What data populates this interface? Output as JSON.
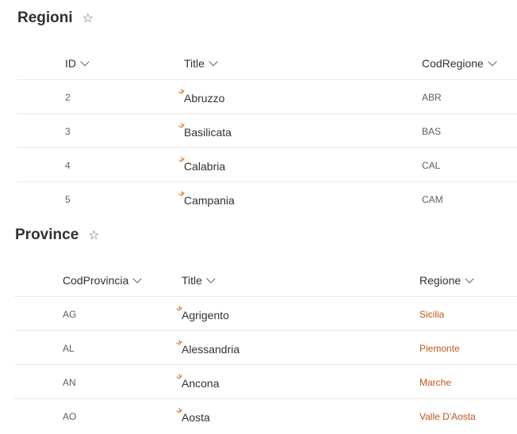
{
  "regioni": {
    "title": "Regioni",
    "star": "☆",
    "columns": {
      "id": "ID",
      "title": "Title",
      "cod": "CodRegione"
    },
    "rows": [
      {
        "id": "2",
        "title": "Abruzzo",
        "cod": "ABR"
      },
      {
        "id": "3",
        "title": "Basilicata",
        "cod": "BAS"
      },
      {
        "id": "4",
        "title": "Calabria",
        "cod": "CAL"
      },
      {
        "id": "5",
        "title": "Campania",
        "cod": "CAM"
      }
    ]
  },
  "province": {
    "title": "Province",
    "star": "☆",
    "columns": {
      "cod": "CodProvincia",
      "title": "Title",
      "regione": "Regione"
    },
    "rows": [
      {
        "cod": "AG",
        "title": "Agrigento",
        "regione": "Sicilia"
      },
      {
        "cod": "AL",
        "title": "Alessandria",
        "regione": "Piemonte"
      },
      {
        "cod": "AN",
        "title": "Ancona",
        "regione": "Marche"
      },
      {
        "cod": "AO",
        "title": "Aosta",
        "regione": "Valle D'Aosta"
      }
    ]
  },
  "colors": {
    "new_item_icon": "#d97a2c",
    "link": "#c2561b"
  }
}
